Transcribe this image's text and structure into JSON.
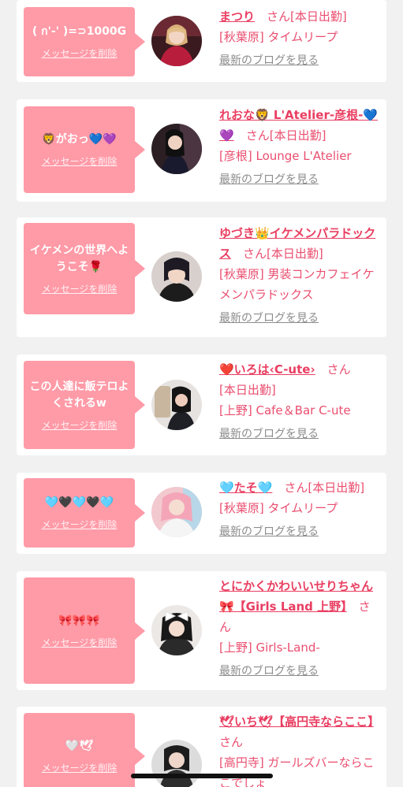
{
  "ui": {
    "delete_label": "メッセージを削除",
    "blog_label": "最新のブログを見る",
    "honorific": "さん",
    "accent_color": "#ff9aa7",
    "name_color": "#e93e61"
  },
  "cards": [
    {
      "message": "( ก'-' )=⊃1000G",
      "name": "まつり",
      "status": "[本日出勤]",
      "shop": "[秋葉原] タイムリープ",
      "avatar_icon": "portrait-red-dress"
    },
    {
      "message": "🦁がおっ💙💜",
      "name": "れおな🦁 L'Atelier-彦根-💙💜",
      "status": "[本日出勤]",
      "shop": "[彦根] Lounge L'Atelier",
      "avatar_icon": "portrait-black-dress"
    },
    {
      "message": "イケメンの世界へようこそ🌹",
      "name": "ゆづき👑イケメンパラドックス",
      "status": "[本日出勤]",
      "shop": "[秋葉原] 男装コンカフェイケメンパラドックス",
      "avatar_icon": "portrait-short-hair"
    },
    {
      "message": "この人達に飯テロよくされるw",
      "name": "❤️いろは‹C-ute›",
      "status": "[本日出勤]",
      "shop": "[上野] Cafe＆Bar C-ute",
      "avatar_icon": "portrait-mirror-selfie"
    },
    {
      "message": "🩵🖤🩵🖤🩵",
      "name": "🩵たそ🩵",
      "status": "[本日出勤]",
      "shop": "[秋葉原] タイムリープ",
      "avatar_icon": "portrait-pink-hair"
    },
    {
      "message": "🎀🎀🎀",
      "name": "とにかくかわいいせりちゃん🎀【Girls Land 上野】",
      "status": "",
      "shop": "[上野] Girls-Land-",
      "avatar_icon": "portrait-white-bow"
    },
    {
      "message": "🤍🕊",
      "name": "🕊いち🕊【高円寺ならここ】",
      "status": "",
      "shop": "[高円寺] ガールズバーならここでしょ",
      "avatar_icon": "portrait-selfie"
    }
  ]
}
